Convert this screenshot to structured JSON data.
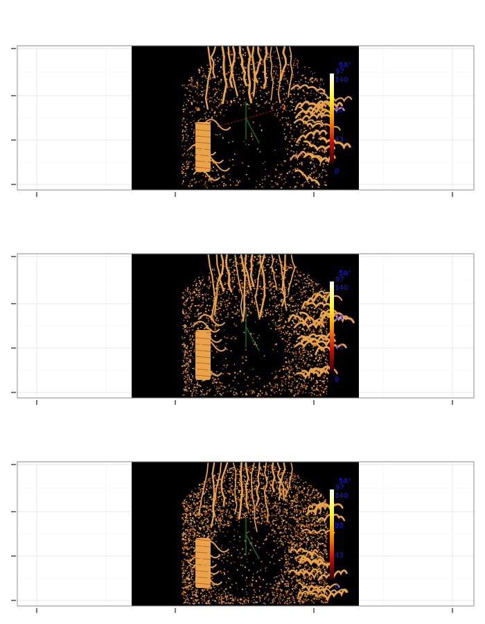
{
  "chart_data": [
    {
      "type": "image",
      "panel": "top",
      "image": "microvasculature-render-sparse",
      "colorbar": {
        "unit_label": "5A°",
        "top_label": "97",
        "tick_labels": [
          "140",
          "93",
          "43",
          "0"
        ],
        "gradient": [
          "#ffffff",
          "#ffff33",
          "#ff9900",
          "#cc1100",
          "#330000"
        ]
      },
      "points": 1500,
      "grid": true
    },
    {
      "type": "image",
      "panel": "middle",
      "image": "microvasculature-render-medium",
      "colorbar": {
        "unit_label": "5A°",
        "top_label": "97",
        "tick_labels": [
          "140",
          "93",
          "43",
          "0"
        ],
        "gradient": [
          "#ffffff",
          "#ffff33",
          "#ff9900",
          "#cc1100",
          "#330000"
        ]
      },
      "points": 2600,
      "grid": true
    },
    {
      "type": "image",
      "panel": "bottom",
      "image": "microvasculature-render-dense",
      "colorbar": {
        "unit_label": "5A°",
        "top_label": "97",
        "tick_labels": [
          "140",
          "93",
          "43",
          "0"
        ],
        "gradient": [
          "#ffffff",
          "#ffff33",
          "#ff9900",
          "#cc1100",
          "#330000"
        ]
      },
      "points": 4200,
      "grid": true
    }
  ],
  "colors": {
    "background": "#ffffff",
    "render_background": "#000000",
    "vessel": "#e8a24a",
    "vessel_dark": "#b8661e",
    "colorbar_text": "#1a1aff",
    "axis_green": "#1f9a1f",
    "axis_red": "#aa1111"
  }
}
